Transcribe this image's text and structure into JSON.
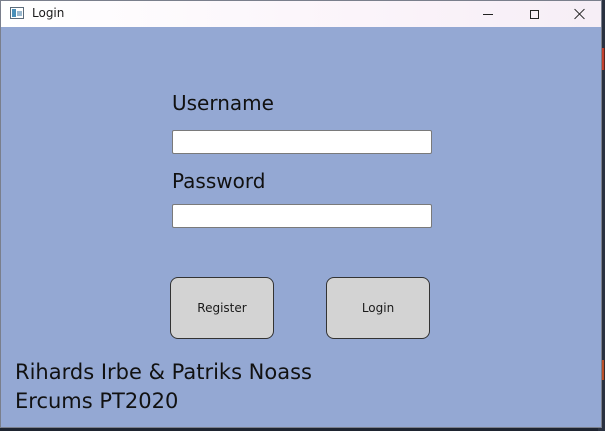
{
  "window": {
    "title": "Login",
    "background_color": "#94a8d3",
    "caption_buttons": {
      "minimize_icon": "minimize-icon",
      "maximize_icon": "maximize-icon",
      "close_icon": "close-icon"
    }
  },
  "form": {
    "username_label": "Username",
    "username_value": "",
    "password_label": "Password",
    "password_value": ""
  },
  "buttons": {
    "register_label": "Register",
    "login_label": "Login",
    "button_color": "#d3d3d3"
  },
  "credits": {
    "line1": "Rihards Irbe & Patriks Noass",
    "line2": "Ercums PT2020"
  }
}
